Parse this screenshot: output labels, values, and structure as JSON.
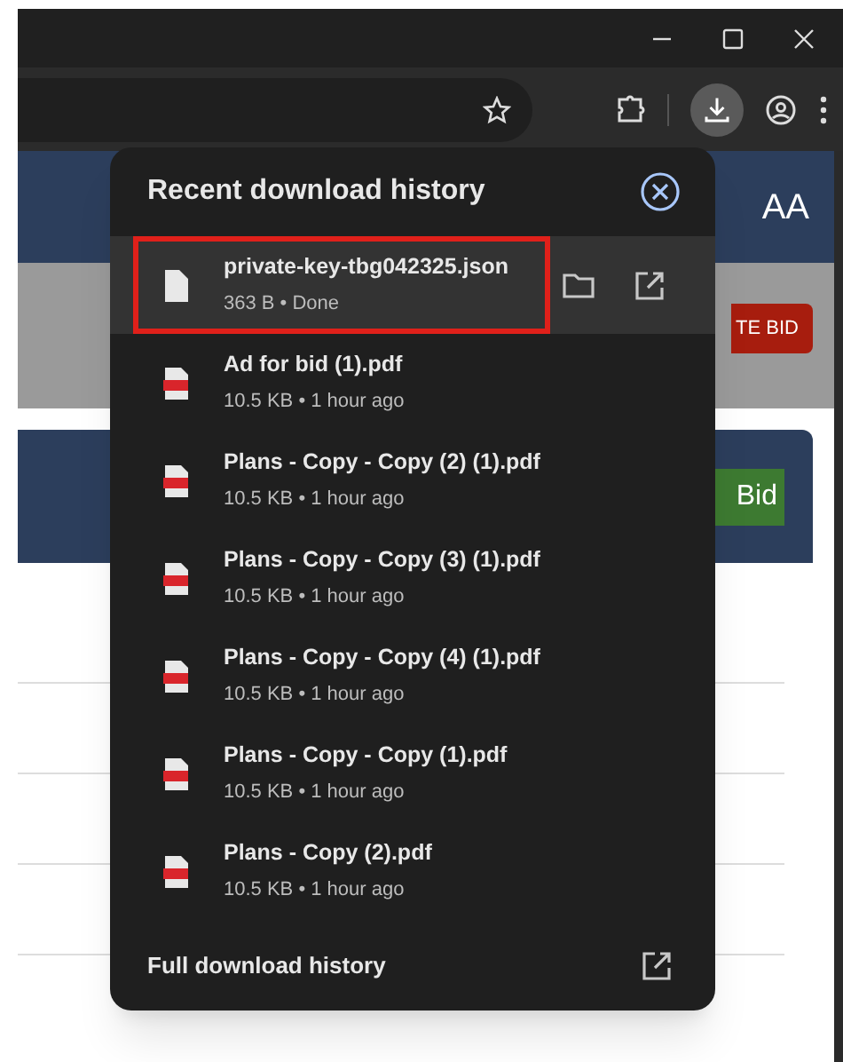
{
  "page": {
    "header_badge": "AA",
    "red_button": "TE BID",
    "green_button": "Bid"
  },
  "downloads_panel": {
    "title": "Recent download history",
    "items": [
      {
        "kind": "file",
        "name": "private-key-tbg042325.json",
        "detail": "363 B • Done",
        "highlighted": true
      },
      {
        "kind": "pdf",
        "name": "Ad for bid (1).pdf",
        "detail": "10.5 KB • 1 hour ago",
        "highlighted": false
      },
      {
        "kind": "pdf",
        "name": "Plans - Copy - Copy (2) (1).pdf",
        "detail": "10.5 KB • 1 hour ago",
        "highlighted": false
      },
      {
        "kind": "pdf",
        "name": "Plans - Copy - Copy (3) (1).pdf",
        "detail": "10.5 KB • 1 hour ago",
        "highlighted": false
      },
      {
        "kind": "pdf",
        "name": "Plans - Copy - Copy (4) (1).pdf",
        "detail": "10.5 KB • 1 hour ago",
        "highlighted": false
      },
      {
        "kind": "pdf",
        "name": "Plans - Copy - Copy (1).pdf",
        "detail": "10.5 KB • 1 hour ago",
        "highlighted": false
      },
      {
        "kind": "pdf",
        "name": "Plans - Copy (2).pdf",
        "detail": "10.5 KB • 1 hour ago",
        "highlighted": false
      }
    ],
    "footer": "Full download history"
  }
}
